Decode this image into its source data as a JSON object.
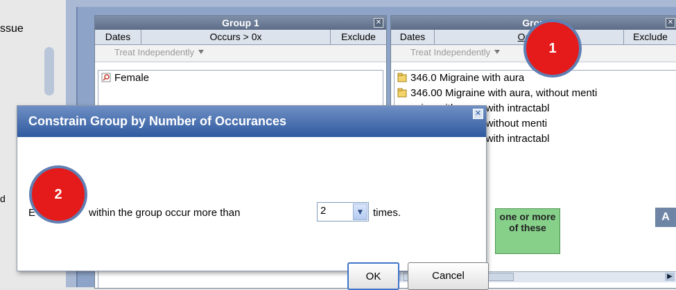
{
  "left_panel": {
    "label_fragment": "ssue",
    "lower_fragment": "d"
  },
  "group1": {
    "title": "Group 1",
    "col_dates": "Dates",
    "col_occurs": "Occurs > 0x",
    "col_exclude": "Exclude",
    "treat": "Treat Independently",
    "items": [
      "Female"
    ]
  },
  "group2": {
    "title": "Grou",
    "col_dates": "Dates",
    "col_occurs": "Occu",
    "col_exclude": "Exclude",
    "treat": "Treat Independently",
    "items": [
      "346.0 Migraine with aura",
      "346.00 Migraine with aura, without menti",
      "raine with aura, with intractabl",
      "raine with aura, without menti",
      "raine with aura, with intractabl"
    ],
    "green_box": "one or more of these",
    "right_button": "A"
  },
  "dialog": {
    "title": "Constrain Group by Number of Occurances",
    "message_prefix": "E",
    "message_middle": "within the group occur more than",
    "count_value": "2",
    "message_suffix": "times.",
    "ok_label": "OK",
    "cancel_label": "Cancel"
  },
  "callouts": {
    "one": "1",
    "two": "2"
  },
  "colors": {
    "callout_fill": "#e51a1a",
    "callout_ring": "#5f7fb4",
    "dialog_title": "#2f5a9f",
    "green_box": "#86d08a"
  }
}
